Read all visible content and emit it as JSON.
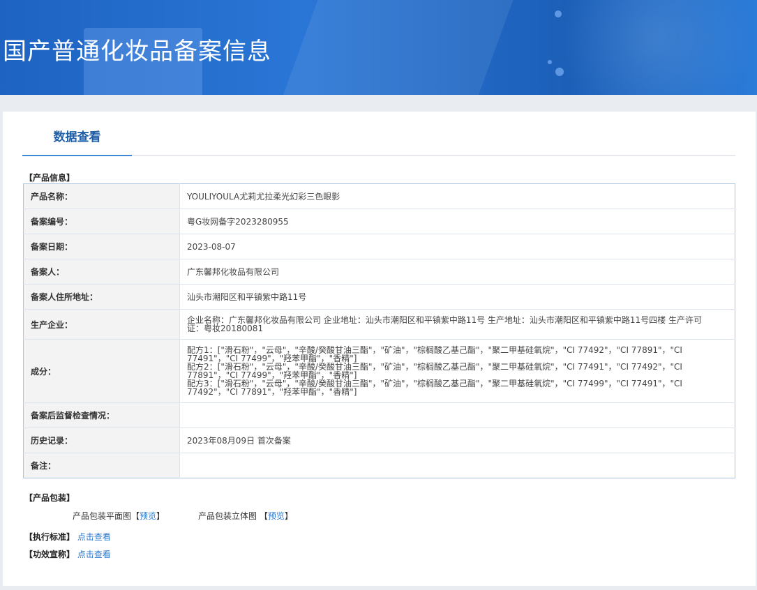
{
  "header": {
    "title": "国产普通化妆品备案信息"
  },
  "tabs": [
    {
      "label": "数据查看"
    }
  ],
  "product_info": {
    "section_title": "【产品信息】",
    "rows": [
      {
        "label": "产品名称：",
        "value": "YOULIYOULA尤莉尤拉柔光幻彩三色眼影"
      },
      {
        "label": "备案编号：",
        "value": "粤G妆网备字2023280955"
      },
      {
        "label": "备案日期：",
        "value": "2023-08-07"
      },
      {
        "label": "备案人：",
        "value": "广东馨邦化妆品有限公司"
      },
      {
        "label": "备案人住所地址：",
        "value": "汕头市潮阳区和平镇紫中路11号"
      },
      {
        "label": "生产企业：",
        "value": "企业名称：广东馨邦化妆品有限公司 企业地址：汕头市潮阳区和平镇紫中路11号 生产地址：汕头市潮阳区和平镇紫中路11号四楼 生产许可证：粤妆20180081"
      },
      {
        "label": "成分：",
        "value_lines": [
          "配方1：[\"滑石粉\"，\"云母\"，\"辛酸/癸酸甘油三酯\"，\"矿油\"，\"棕榈酸乙基己酯\"，\"聚二甲基硅氧烷\"，\"CI 77492\"，\"CI 77891\"，\"CI 77491\"，\"CI 77499\"，\"羟苯甲酯\"，\"香精\"]",
          "配方2：[\"滑石粉\"，\"云母\"，\"辛酸/癸酸甘油三酯\"，\"矿油\"，\"棕榈酸乙基己酯\"，\"聚二甲基硅氧烷\"，\"CI 77491\"，\"CI 77492\"，\"CI 77891\"，\"CI 77499\"，\"羟苯甲酯\"，\"香精\"]",
          "配方3：[\"滑石粉\"，\"云母\"，\"辛酸/癸酸甘油三酯\"，\"矿油\"，\"棕榈酸乙基己酯\"，\"聚二甲基硅氧烷\"，\"CI 77499\"，\"CI 77491\"，\"CI 77492\"，\"CI 77891\"，\"羟苯甲酯\"，\"香精\"]"
        ]
      },
      {
        "label": "备案后监督检查情况：",
        "value": ""
      },
      {
        "label": "历史记录：",
        "value": "2023年08月09日 首次备案"
      },
      {
        "label": "备注：",
        "value": ""
      }
    ]
  },
  "packaging": {
    "section_title": "【产品包装】",
    "flat_label": "产品包装平面图",
    "solid_label": "产品包装立体图",
    "bracket_open": "【",
    "bracket_close": "】",
    "preview_link": "预览"
  },
  "standard": {
    "section_title": "【执行标准】",
    "link": "点击查看"
  },
  "efficacy": {
    "section_title": "【功效宣称】",
    "link": "点击查看"
  },
  "colors": {
    "banner": "#1e63c1",
    "link": "#2d77c9",
    "tab_text": "#1f5fa8",
    "table_border": "#a9c4e6"
  }
}
